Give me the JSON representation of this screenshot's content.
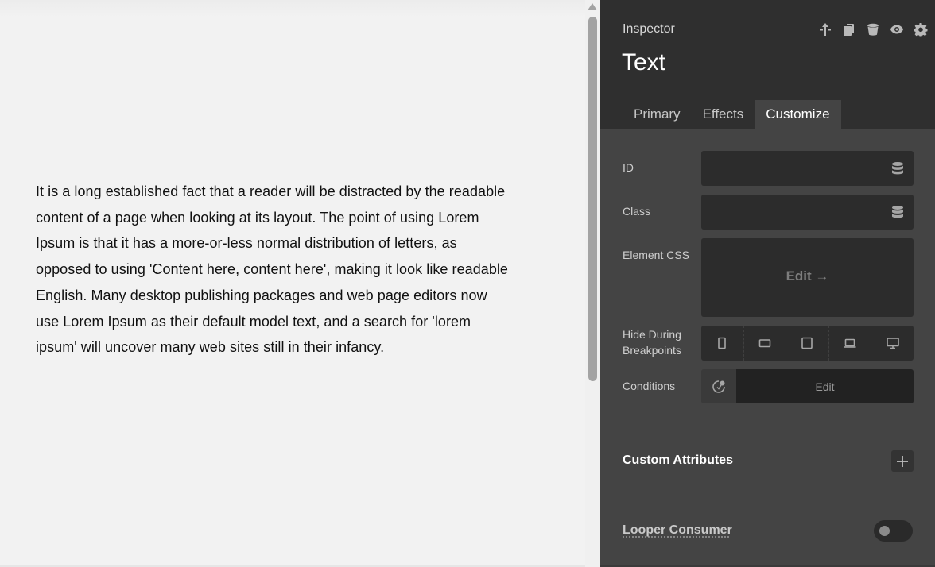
{
  "canvas": {
    "paragraph": "It is a long established fact that a reader will be distracted by the readable content of a page when looking at its layout. The point of using Lorem Ipsum is that it has a more-or-less normal distribution of letters, as opposed to using 'Content here, content here', making it look like readable English. Many desktop publishing packages and web page editors now use Lorem Ipsum as their default model text, and a search for 'lorem ipsum' will uncover many web sites still in their infancy."
  },
  "inspector": {
    "label": "Inspector",
    "title": "Text",
    "header_icons": [
      "move-up-icon",
      "duplicate-icon",
      "delete-icon",
      "visibility-icon",
      "settings-icon"
    ],
    "tabs": [
      {
        "label": "Primary",
        "active": false
      },
      {
        "label": "Effects",
        "active": false
      },
      {
        "label": "Customize",
        "active": true
      }
    ],
    "fields": {
      "id_label": "ID",
      "id_value": "",
      "class_label": "Class",
      "class_value": "",
      "element_css_label": "Element CSS",
      "element_css_edit": "Edit →",
      "hide_label_line1": "Hide During",
      "hide_label_line2": "Breakpoints",
      "breakpoints": [
        "phone-icon",
        "phone-landscape-icon",
        "tablet-icon",
        "laptop-icon",
        "desktop-icon"
      ],
      "conditions_label": "Conditions",
      "conditions_edit": "Edit"
    },
    "custom_attributes": {
      "title": "Custom Attributes"
    },
    "looper_consumer": {
      "title": "Looper Consumer",
      "enabled": false
    }
  },
  "colors": {
    "inspector_bg": "#444444",
    "inspector_header_bg": "#2f2f2f",
    "field_bg": "#2c2c2c",
    "canvas_bg": "#f2f2f2"
  }
}
